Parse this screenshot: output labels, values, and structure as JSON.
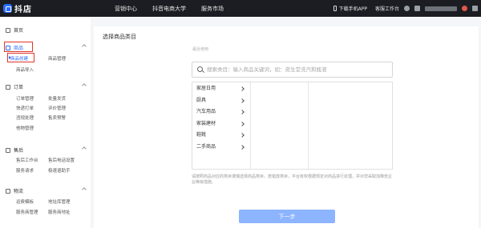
{
  "app": {
    "logo_text": "抖店"
  },
  "top_nav": [
    "营销中心",
    "抖音电商大学",
    "服务市场"
  ],
  "top_right": {
    "download_app": "下载手机APP",
    "workbench": "客服工作台"
  },
  "sidebar": {
    "home": "首页",
    "sections": [
      {
        "label": "商品",
        "links": [
          "商品创建",
          "商品管理",
          "商品导入"
        ]
      },
      {
        "label": "订单",
        "links": [
          "订单管理",
          "批量发货",
          "快递打单",
          "评价管理",
          "违规处理",
          "售卖预警",
          "他物管理"
        ]
      },
      {
        "label": "售后",
        "links": [
          "售后工作台",
          "售后电话设置",
          "服务请求",
          "极速退助手"
        ]
      },
      {
        "label": "物流",
        "links": [
          "运费模板",
          "地址库管理",
          "服务商管理",
          "服务商地址"
        ]
      }
    ]
  },
  "main": {
    "title": "选择商品类目",
    "recent_label": "最近使用",
    "search_placeholder": "搜索类目：输入商品关键词，如：资生堂洗汽和瓶液",
    "categories": [
      "家居日用",
      "厨具",
      "汽车用品",
      "家装建材",
      "鞋靴",
      "二手商品"
    ],
    "note": "请按照商品对应的类目谨慎选择商品类目，若错放类目，平台有权根据规定对商品进行处理，并对您采取加降低企业等级措施。",
    "next_button": "下一步"
  },
  "colors": {
    "topbar": "#1b1d22",
    "accent": "#2b6cff",
    "button_disabled": "#8cb4ff",
    "highlight_box": "#e2352b"
  }
}
